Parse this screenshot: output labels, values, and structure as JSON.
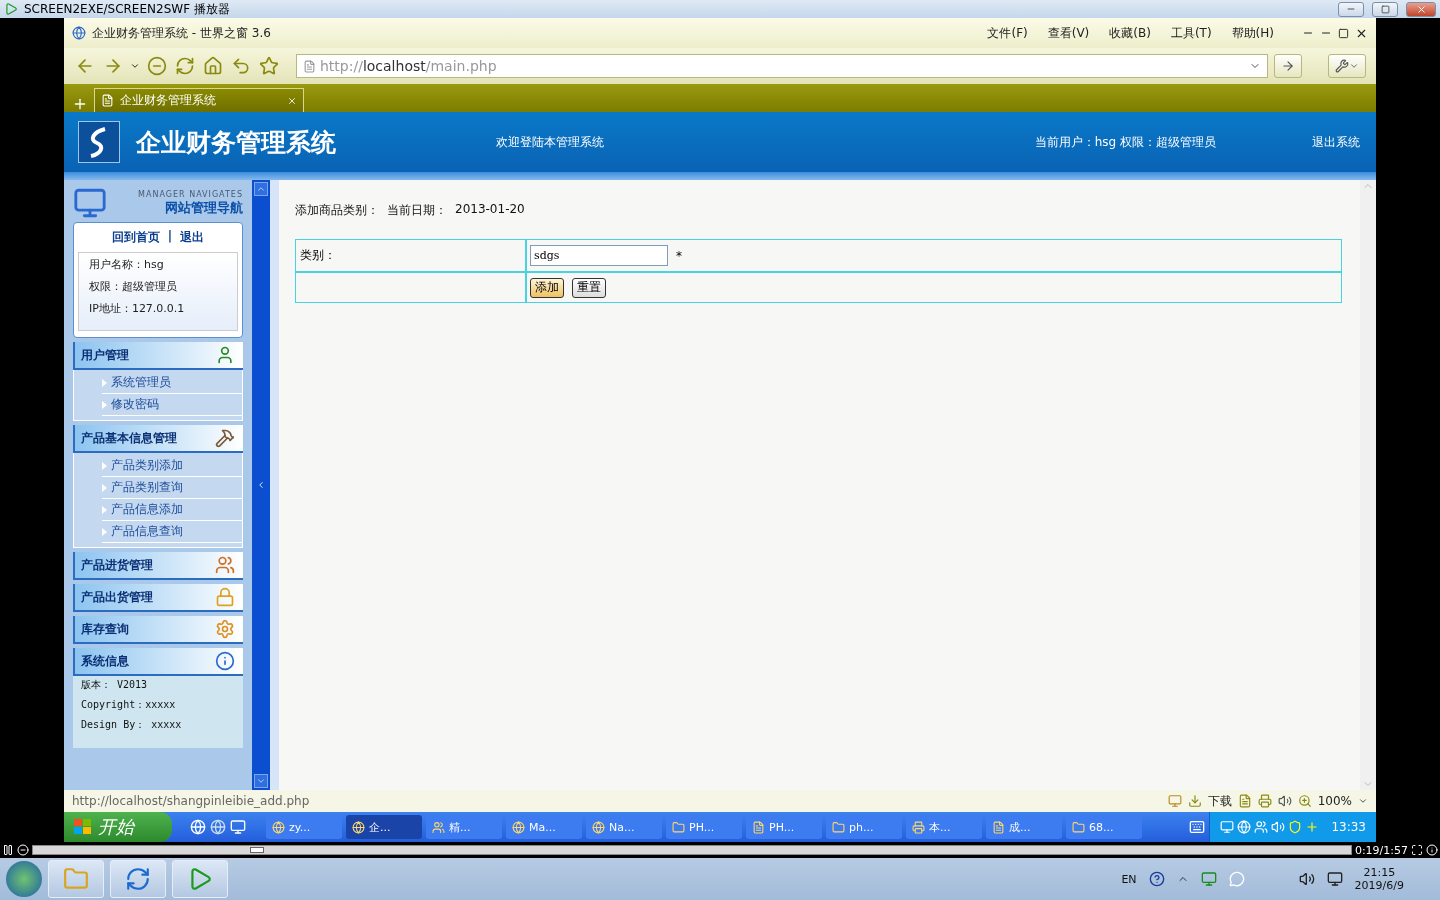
{
  "player": {
    "title": "SCREEN2EXE/SCREEN2SWF 播放器",
    "elapsed": "0:19/1:57",
    "level": 0.17
  },
  "browser": {
    "title": "企业财务管理系统 - 世界之窗 3.6",
    "menu": [
      "文件(F)",
      "查看(V)",
      "收藏(B)",
      "工具(T)",
      "帮助(H)"
    ],
    "address": {
      "prefix": "http://",
      "host": "localhost",
      "path": "/main.php"
    },
    "tabs": [
      {
        "label": "企业财务管理系统",
        "selected": true
      }
    ],
    "status_url": "http://localhost/shangpinleibie_add.php",
    "download_label": "下载",
    "zoom": "100%"
  },
  "site": {
    "title": "企业财务管理系统",
    "welcome": "欢迎登陆本管理系统",
    "user_info": "当前用户：hsg 权限：超级管理员",
    "logout": "退出系统"
  },
  "sidebar": {
    "caption": "MANAGER NAVIGATES",
    "heading": "网站管理导航",
    "links": [
      "回到首页",
      "退出"
    ],
    "link_separator": "|",
    "user": [
      "用户名称：hsg",
      "权限：超级管理员",
      "IP地址：127.0.0.1"
    ],
    "sections": [
      {
        "title": "用户管理",
        "expanded": true,
        "items": [
          "系统管理员",
          "修改密码"
        ]
      },
      {
        "title": "产品基本信息管理",
        "expanded": true,
        "items": [
          "产品类别添加",
          "产品类别查询",
          "产品信息添加",
          "产品信息查询"
        ]
      },
      {
        "title": "产品进货管理"
      },
      {
        "title": "产品出货管理"
      },
      {
        "title": "库存查询"
      },
      {
        "title": "系统信息",
        "expanded": true,
        "info": [
          "版本： V2013",
          "Copyright：xxxxx",
          "Design By： xxxxx"
        ]
      }
    ]
  },
  "content": {
    "heading": "添加商品类别：",
    "date_label": "当前日期：",
    "date": "2013-01-20",
    "form": {
      "label": "类别：",
      "value": "sdgs",
      "required_mark": "*",
      "buttons": [
        "添加",
        "重置"
      ]
    }
  },
  "xp_taskbar": {
    "start": "开始",
    "tasks": [
      {
        "label": "zy...",
        "selected": false
      },
      {
        "label": "企...",
        "selected": true
      },
      {
        "label": "精...",
        "selected": false
      },
      {
        "label": "Ma...",
        "selected": false
      },
      {
        "label": "Na...",
        "selected": false
      },
      {
        "label": "PH...",
        "selected": false
      },
      {
        "label": "PH...",
        "selected": false
      },
      {
        "label": "ph...",
        "selected": false
      },
      {
        "label": "本...",
        "selected": false
      },
      {
        "label": "成...",
        "selected": false
      },
      {
        "label": "68...",
        "selected": false
      }
    ],
    "time": "13:33"
  },
  "win7_taskbar": {
    "language": "EN",
    "time": "21:15",
    "date": "2019/6/9"
  }
}
